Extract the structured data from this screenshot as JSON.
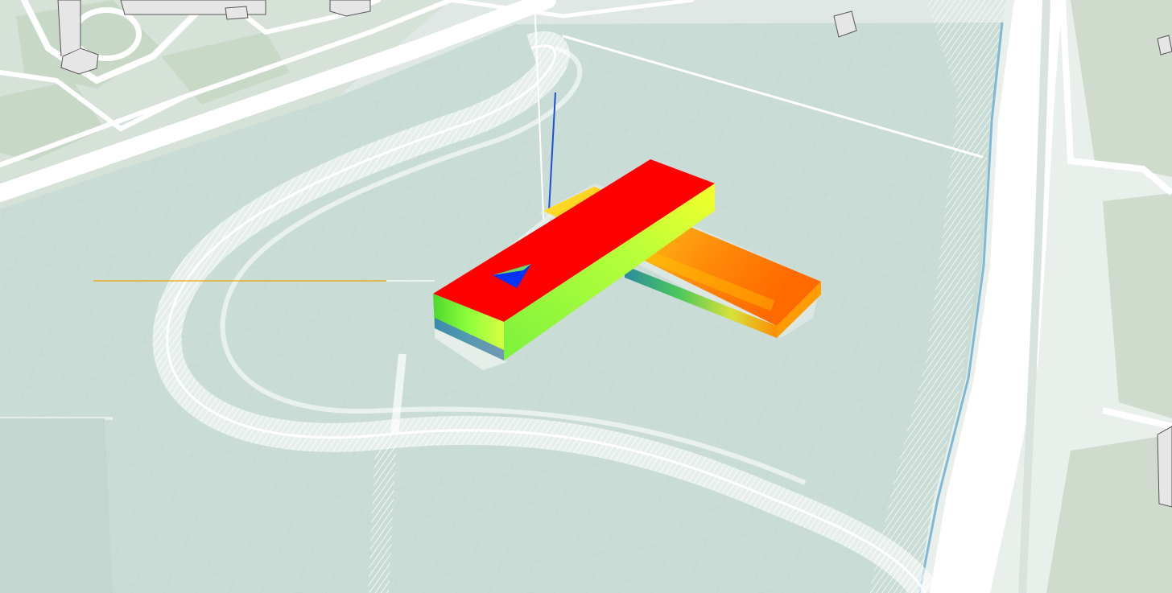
{
  "scene": {
    "view": "3d-map-viewport",
    "colors": {
      "park_tint": "#c9dcd6",
      "road": "#ffffff",
      "water_edge": "#7fb9d6",
      "land": "#d9e3dc",
      "green_area": "#cfdccd",
      "analysis_high": "#ff0000",
      "analysis_mid": "#8cff3c",
      "analysis_low": "#0033ff",
      "analysis_warm": "#ff7a00",
      "axis_x": "#f0a000",
      "axis_y": "#ffffff",
      "axis_z": "#1a4fd6"
    },
    "icons": [
      "axis-gizmo-icon"
    ]
  }
}
